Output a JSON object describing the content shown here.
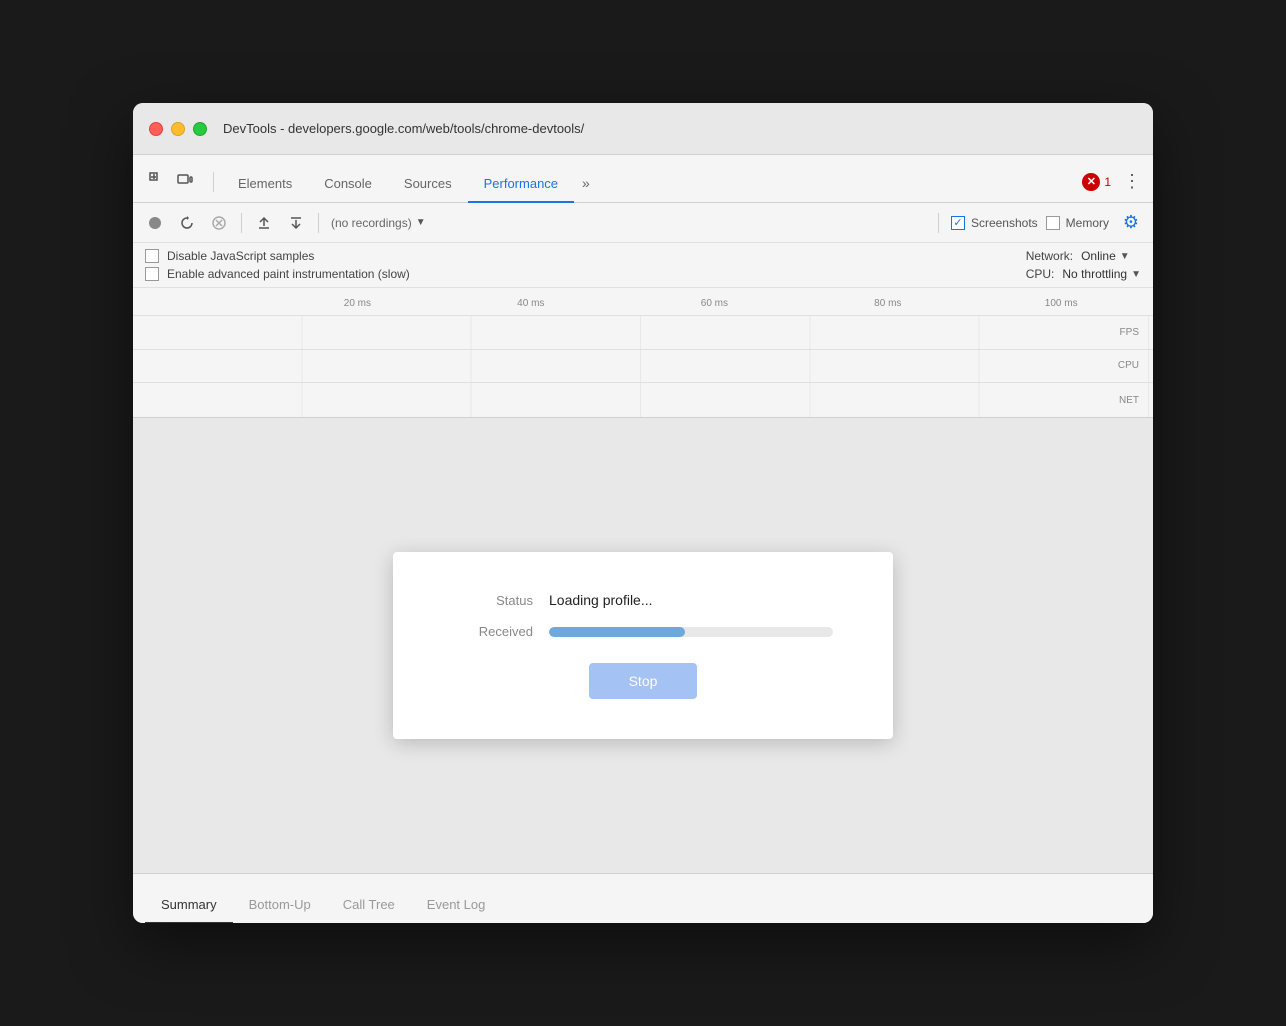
{
  "window": {
    "title": "DevTools - developers.google.com/web/tools/chrome-devtools/"
  },
  "tabs": {
    "items": [
      {
        "label": "Elements",
        "active": false
      },
      {
        "label": "Console",
        "active": false
      },
      {
        "label": "Sources",
        "active": false
      },
      {
        "label": "Performance",
        "active": true
      }
    ],
    "more_label": "»",
    "error_count": "1"
  },
  "toolbar": {
    "record_label": "●",
    "reload_label": "↺",
    "clear_label": "⊘",
    "upload_label": "▲",
    "download_label": "▼",
    "recordings_placeholder": "(no recordings)",
    "screenshots_label": "Screenshots",
    "memory_label": "Memory"
  },
  "settings": {
    "disable_js_label": "Disable JavaScript samples",
    "advanced_paint_label": "Enable advanced paint instrumentation (slow)",
    "network_label": "Network:",
    "network_value": "Online",
    "cpu_label": "CPU:",
    "cpu_value": "No throttling"
  },
  "ruler": {
    "marks": [
      "20 ms",
      "40 ms",
      "60 ms",
      "80 ms",
      "100 ms"
    ]
  },
  "tracks": {
    "fps_label": "FPS",
    "cpu_label": "CPU",
    "net_label": "NET"
  },
  "dialog": {
    "status_label": "Status",
    "status_value": "Loading profile...",
    "received_label": "Received",
    "progress_percent": 48,
    "stop_label": "Stop"
  },
  "bottom_tabs": {
    "items": [
      {
        "label": "Summary",
        "active": true
      },
      {
        "label": "Bottom-Up",
        "active": false
      },
      {
        "label": "Call Tree",
        "active": false
      },
      {
        "label": "Event Log",
        "active": false
      }
    ]
  }
}
